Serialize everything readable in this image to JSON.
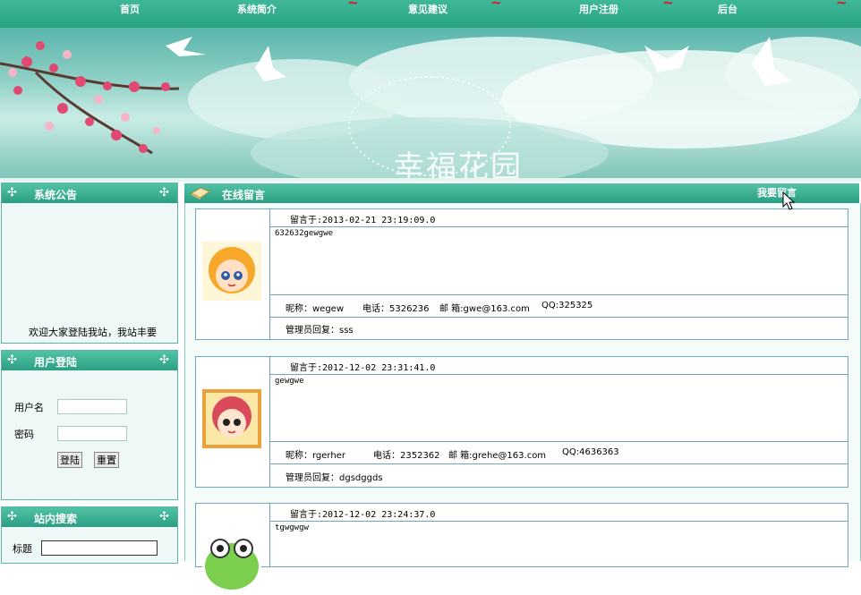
{
  "nav": {
    "items": [
      "首页",
      "系统简介",
      "意见建议",
      "用户注册",
      "后台"
    ]
  },
  "banner": {
    "logo_text": "幸福花园"
  },
  "notice": {
    "title": "系统公告",
    "text": "欢迎大家登陆我站，我站丰要"
  },
  "login": {
    "title": "用户登陆",
    "username_label": "用户名",
    "password_label": "密码",
    "login_button": "登陆",
    "reset_button": "重置"
  },
  "search": {
    "title": "站内搜索",
    "title_label": "标题"
  },
  "board": {
    "title": "在线留言",
    "write_link": "我要留言"
  },
  "messages": [
    {
      "time": "留言于:2013-02-21 23:19:09.0",
      "content": "632632gewgwe",
      "nickname": "昵称：wegew",
      "phone": "电话：5326236",
      "email": "邮 箱:gwe@163.com",
      "qq": "QQ:325325",
      "reply": "管理员回复：sss"
    },
    {
      "time": "留言于:2012-12-02 23:31:41.0",
      "content": "gewgwe",
      "nickname": "昵称：rgerher",
      "phone": "电话：2352362",
      "email": "邮 箱:grehe@163.com",
      "qq": "QQ:4636363",
      "reply": "管理员回复：dgsdggds"
    },
    {
      "time": "留言于:2012-12-02 23:24:37.0",
      "content": "tgwgwgw"
    }
  ],
  "colors": {
    "nav_bg": "#2fa98a",
    "panel_header": "#3bb394",
    "border_blue": "#6fa7c2"
  }
}
